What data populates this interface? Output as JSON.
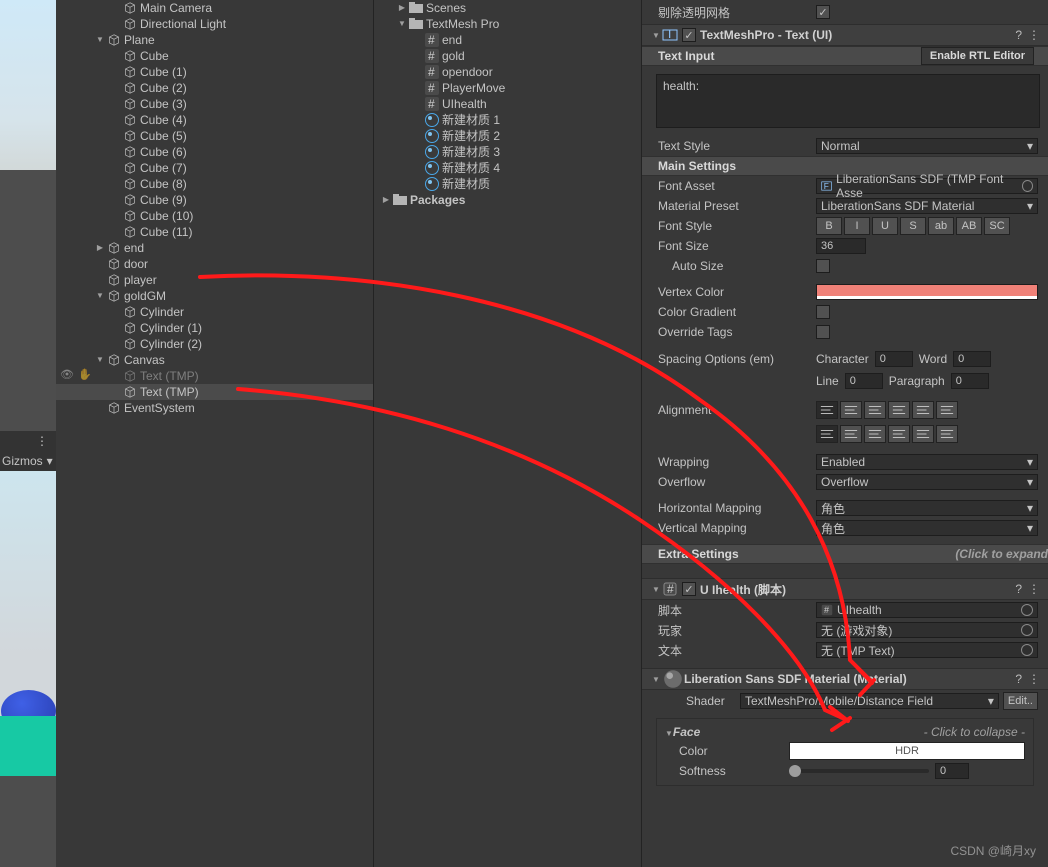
{
  "scene_toolbar": {
    "gizmos": "Gizmos"
  },
  "hierarchy": [
    {
      "lvl": 3,
      "expand": "",
      "icon": "cube",
      "label": "Main Camera"
    },
    {
      "lvl": 3,
      "expand": "",
      "icon": "cube",
      "label": "Directional Light"
    },
    {
      "lvl": 2,
      "expand": "down",
      "icon": "cube",
      "label": "Plane"
    },
    {
      "lvl": 3,
      "expand": "",
      "icon": "cube",
      "label": "Cube"
    },
    {
      "lvl": 3,
      "expand": "",
      "icon": "cube",
      "label": "Cube (1)"
    },
    {
      "lvl": 3,
      "expand": "",
      "icon": "cube",
      "label": "Cube (2)"
    },
    {
      "lvl": 3,
      "expand": "",
      "icon": "cube",
      "label": "Cube (3)"
    },
    {
      "lvl": 3,
      "expand": "",
      "icon": "cube",
      "label": "Cube (4)"
    },
    {
      "lvl": 3,
      "expand": "",
      "icon": "cube",
      "label": "Cube (5)"
    },
    {
      "lvl": 3,
      "expand": "",
      "icon": "cube",
      "label": "Cube (6)"
    },
    {
      "lvl": 3,
      "expand": "",
      "icon": "cube",
      "label": "Cube (7)"
    },
    {
      "lvl": 3,
      "expand": "",
      "icon": "cube",
      "label": "Cube (8)"
    },
    {
      "lvl": 3,
      "expand": "",
      "icon": "cube",
      "label": "Cube (9)"
    },
    {
      "lvl": 3,
      "expand": "",
      "icon": "cube",
      "label": "Cube (10)"
    },
    {
      "lvl": 3,
      "expand": "",
      "icon": "cube",
      "label": "Cube (11)"
    },
    {
      "lvl": 2,
      "expand": "right",
      "icon": "cube",
      "label": "end"
    },
    {
      "lvl": 2,
      "expand": "",
      "icon": "cube",
      "label": "door"
    },
    {
      "lvl": 2,
      "expand": "",
      "icon": "cube",
      "label": "player"
    },
    {
      "lvl": 2,
      "expand": "down",
      "icon": "cube",
      "label": "goldGM"
    },
    {
      "lvl": 3,
      "expand": "",
      "icon": "cube",
      "label": "Cylinder"
    },
    {
      "lvl": 3,
      "expand": "",
      "icon": "cube",
      "label": "Cylinder (1)"
    },
    {
      "lvl": 3,
      "expand": "",
      "icon": "cube",
      "label": "Cylinder (2)"
    },
    {
      "lvl": 2,
      "expand": "down",
      "icon": "cube",
      "label": "Canvas"
    },
    {
      "lvl": 3,
      "expand": "",
      "icon": "cube",
      "label": "Text (TMP)",
      "dim": true
    },
    {
      "lvl": 3,
      "expand": "",
      "icon": "cube",
      "label": "Text (TMP)",
      "sel": true
    },
    {
      "lvl": 2,
      "expand": "",
      "icon": "cube",
      "label": "EventSystem"
    }
  ],
  "project": [
    {
      "lvl": 1,
      "expand": "right",
      "icon": "folder",
      "label": "Scenes"
    },
    {
      "lvl": 1,
      "expand": "down",
      "icon": "folder",
      "label": "TextMesh Pro"
    },
    {
      "lvl": 2,
      "expand": "",
      "icon": "hash",
      "label": "end"
    },
    {
      "lvl": 2,
      "expand": "",
      "icon": "hash",
      "label": "gold"
    },
    {
      "lvl": 2,
      "expand": "",
      "icon": "hash",
      "label": "opendoor"
    },
    {
      "lvl": 2,
      "expand": "",
      "icon": "hash",
      "label": "PlayerMove"
    },
    {
      "lvl": 2,
      "expand": "",
      "icon": "hash",
      "label": "UIhealth"
    },
    {
      "lvl": 2,
      "expand": "",
      "icon": "mat",
      "label": "新建材质 1"
    },
    {
      "lvl": 2,
      "expand": "",
      "icon": "mat",
      "label": "新建材质 2"
    },
    {
      "lvl": 2,
      "expand": "",
      "icon": "mat",
      "label": "新建材质 3"
    },
    {
      "lvl": 2,
      "expand": "",
      "icon": "mat",
      "label": "新建材质 4"
    },
    {
      "lvl": 2,
      "expand": "",
      "icon": "mat",
      "label": "新建材质"
    },
    {
      "lvl": 0,
      "expand": "right",
      "icon": "folder",
      "label": "Packages",
      "bold": true
    }
  ],
  "inspector": {
    "cull_mesh": {
      "label": "剔除透明网格",
      "checked": true
    },
    "component_title": "TextMeshPro - Text (UI)",
    "text_input_hdr": "Text Input",
    "rtl_button": "Enable RTL Editor",
    "text_value": "health:",
    "text_style": {
      "label": "Text Style",
      "value": "Normal"
    },
    "main_settings_hdr": "Main Settings",
    "font_asset": {
      "label": "Font Asset",
      "value": "LiberationSans SDF (TMP Font Asse"
    },
    "material_preset": {
      "label": "Material Preset",
      "value": "LiberationSans SDF Material"
    },
    "font_style": {
      "label": "Font Style",
      "buttons": [
        "B",
        "I",
        "U",
        "S",
        "ab",
        "AB",
        "SC"
      ]
    },
    "font_size": {
      "label": "Font Size",
      "value": "36"
    },
    "auto_size": {
      "label": "Auto Size",
      "checked": false
    },
    "vertex_color": {
      "label": "Vertex Color",
      "hex": "#f08178"
    },
    "color_gradient": {
      "label": "Color Gradient",
      "checked": false
    },
    "override_tags": {
      "label": "Override Tags",
      "checked": false
    },
    "spacing": {
      "label": "Spacing Options (em)",
      "character": {
        "label": "Character",
        "value": "0"
      },
      "word": {
        "label": "Word",
        "value": "0"
      },
      "line": {
        "label": "Line",
        "value": "0"
      },
      "paragraph": {
        "label": "Paragraph",
        "value": "0"
      }
    },
    "alignment": {
      "label": "Alignment"
    },
    "wrapping": {
      "label": "Wrapping",
      "value": "Enabled"
    },
    "overflow": {
      "label": "Overflow",
      "value": "Overflow"
    },
    "h_mapping": {
      "label": "Horizontal Mapping",
      "value": "角色"
    },
    "v_mapping": {
      "label": "Vertical Mapping",
      "value": "角色"
    },
    "extra_settings_hdr": "Extra Settings",
    "extra_hint": "(Click to expand",
    "script_comp": {
      "title": "U Ihealth   (脚本)",
      "rows": [
        {
          "label": "脚本",
          "value": "UIhealth",
          "icon": "hash"
        },
        {
          "label": "玩家",
          "value": "无 (游戏对象)"
        },
        {
          "label": "文本",
          "value": "无 (TMP Text)"
        }
      ]
    },
    "material": {
      "title": "Liberation Sans SDF Material (Material)",
      "shader_label": "Shader",
      "shader_value": "TextMeshPro/Mobile/Distance Field",
      "edit_btn": "Edit..",
      "face_title": "Face",
      "face_hint": "- Click to collapse -",
      "color_label": "Color",
      "color_btn": "HDR",
      "softness_label": "Softness",
      "softness_value": "0"
    }
  },
  "watermark": "CSDN @崎月xy"
}
